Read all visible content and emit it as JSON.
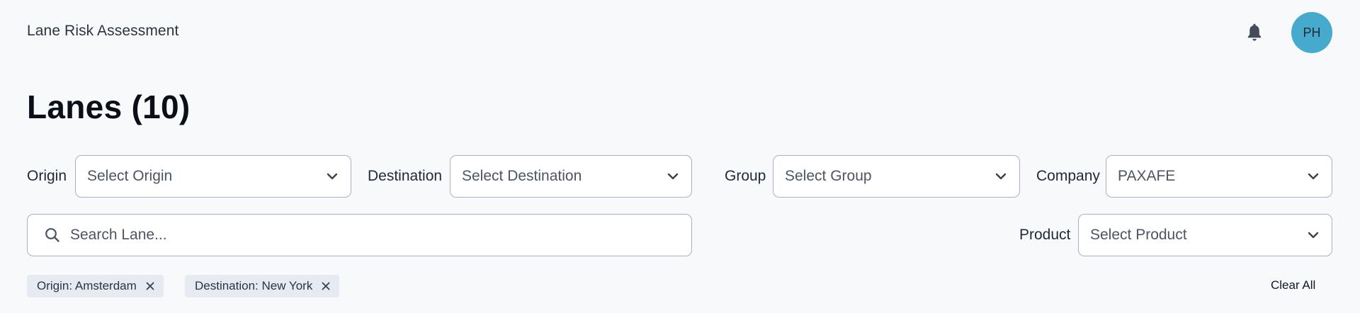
{
  "header": {
    "app_title": "Lane Risk Assessment",
    "notification_icon": "bell-icon",
    "avatar_initials": "PH",
    "avatar_color": "#46aacd"
  },
  "page": {
    "title": "Lanes (10)"
  },
  "filters": {
    "origin": {
      "label": "Origin",
      "value": "Select Origin"
    },
    "destination": {
      "label": "Destination",
      "value": "Select Destination"
    },
    "group": {
      "label": "Group",
      "value": "Select Group"
    },
    "company": {
      "label": "Company",
      "value": "PAXAFE"
    },
    "product": {
      "label": "Product",
      "value": "Select Product"
    },
    "search": {
      "placeholder": "Search Lane...",
      "value": ""
    }
  },
  "active_filters": {
    "chips": [
      {
        "label": "Origin: Amsterdam"
      },
      {
        "label": "Destination: New York"
      }
    ],
    "clear_all_label": "Clear All"
  },
  "colors": {
    "background": "#f8f9fb",
    "input_border": "#a9b2c3",
    "chip_background": "#e6eaf1"
  }
}
